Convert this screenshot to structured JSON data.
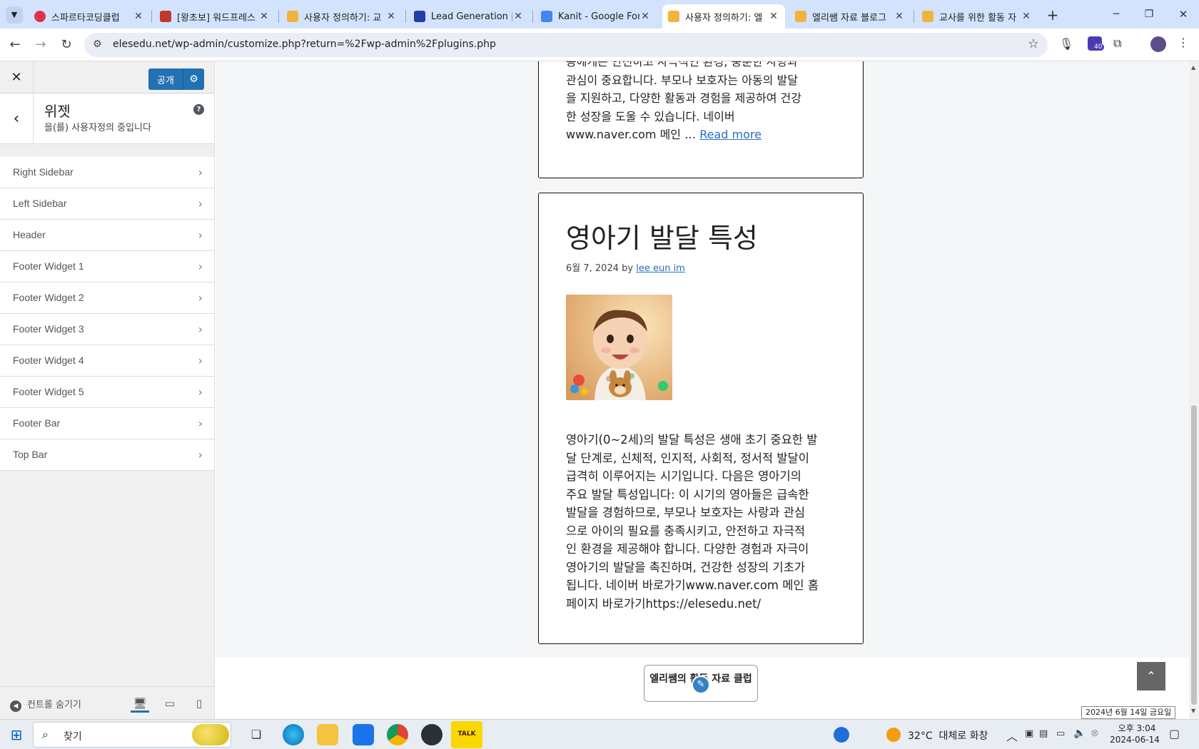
{
  "browser": {
    "tabs": [
      {
        "title": "스파르타코딩클럽",
        "color": "#e0304d"
      },
      {
        "title": "[왕초보] 워드프레스",
        "color": "#c0392b"
      },
      {
        "title": "사용자 정의하기: 교",
        "color": "#f2b33d"
      },
      {
        "title": "Lead Generation | S",
        "color": "#1f3ea8"
      },
      {
        "title": "Kanit - Google Font",
        "color": "#4285f4"
      },
      {
        "title": "사용자 정의하기: 엘",
        "color": "#f2b33d"
      },
      {
        "title": "엘리쌤 자료 블로그",
        "color": "#f2b33d"
      },
      {
        "title": "교사를 위한 활동 자",
        "color": "#f2b33d"
      }
    ],
    "url": "elesedu.net/wp-admin/customize.php?return=%2Fwp-admin%2Fplugins.php",
    "extension_badge": "40"
  },
  "customizer": {
    "publish_label": "공개",
    "section_subtitle": "을(를) 사용자정의 중입니다",
    "section_title": "위젯",
    "help_glyph": "?",
    "widget_areas": [
      "Right Sidebar",
      "Left Sidebar",
      "Header",
      "Footer Widget 1",
      "Footer Widget 2",
      "Footer Widget 3",
      "Footer Widget 4",
      "Footer Widget 5",
      "Footer Bar",
      "Top Bar"
    ],
    "hide_controls_label": "컨트롤 숨기기"
  },
  "preview": {
    "post1": {
      "excerpt_lines": [
        "동에게는 안전하고 자극적인 환경, 충분한 사랑과",
        "관심이 중요합니다. 부모나 보호자는 아동의 발달",
        "을 지원하고, 다양한 활동과 경험을 제공하여 건강",
        "한 성장을 도울 수 있습니다. 네이버"
      ],
      "last_line_text": "www.naver.com 메인 … ",
      "read_more": "Read more"
    },
    "post2": {
      "title": "영아기 발달 특성",
      "date": "6월 7, 2024",
      "by": "by",
      "author": "lee eun im",
      "body_lines": [
        "영아기(0~2세)의 발달 특성은 생애 초기 중요한 발",
        "달 단계로, 신체적, 인지적, 사회적, 정서적 발달이",
        "급격히 이루어지는 시기입니다. 다음은 영아기의",
        "주요 발달 특성입니다: 이 시기의 영아들은 급속한",
        "발달을 경험하므로, 부모나 보호자는 사랑과 관심",
        "으로 아이의 필요를 충족시키고, 안전하고 자극적",
        "인 환경을 제공해야 합니다. 다양한 경험과 자극이",
        "영아기의 발달을 촉진하며, 건강한 성장의 기초가",
        "됩니다. 네이버 바로가기www.naver.com 메인 홈",
        "페이지 바로가기https://elesedu.net/"
      ]
    },
    "footer_text": "엘리쌤의 활동 자료 클럽",
    "tooltip": "2024년 6월 14일 금요일"
  },
  "taskbar": {
    "search_placeholder": "찾기",
    "weather": "32°C  대체로 화창",
    "time": "오후 3:04",
    "date": "2024-06-14",
    "kakao": "TALK"
  }
}
